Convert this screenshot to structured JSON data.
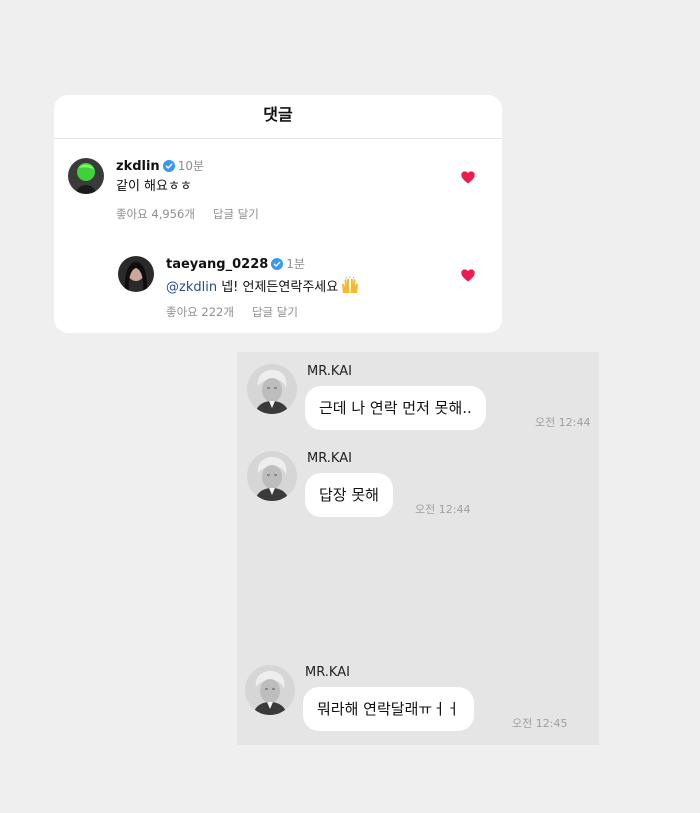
{
  "comments": {
    "title": "댓글",
    "items": [
      {
        "username": "zkdlin",
        "time": "10분",
        "mention": "",
        "text": "같이 해요ㅎㅎ",
        "likes_label": "좋아요 4,956개",
        "reply_label": "답글 달기",
        "liked": true
      },
      {
        "username": "taeyang_0228",
        "time": "1분",
        "mention": "@zkdlin",
        "text": " 넵! 언제든연락주세요",
        "emoji": "raising-hands",
        "likes_label": "좋아요 222개",
        "reply_label": "답글 달기",
        "liked": true
      }
    ],
    "heart_color": "#ed1c4d",
    "verified_color": "#3897f0"
  },
  "chat": {
    "messages": [
      {
        "sender": "MR.KAI",
        "text": "근데 나 연락 먼저 못해..",
        "time": "오전 12:44"
      },
      {
        "sender": "MR.KAI",
        "text": "답장 못해",
        "time": "오전 12:44"
      },
      {
        "sender": "MR.KAI",
        "text": "뭐라해 연락달래ㅠㅓㅓ",
        "time": "오전 12:45"
      }
    ]
  }
}
